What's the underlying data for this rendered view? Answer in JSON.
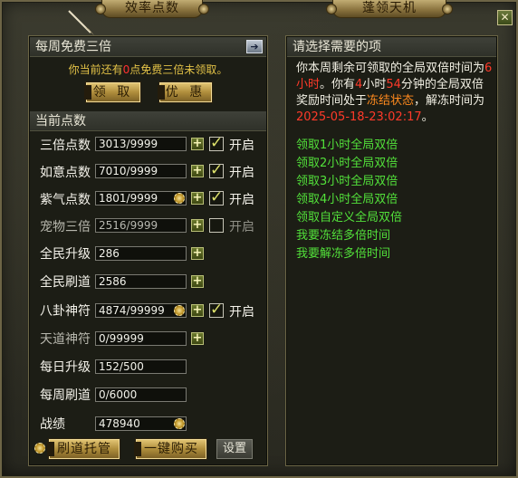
{
  "tabs": {
    "left": "效率点数",
    "right": "蓬领天机"
  },
  "left_panel": {
    "weekly_title": "每周免费三倍",
    "notice_pre": "你当前还有",
    "notice_num": "0",
    "notice_post": "点免费三倍未领取。",
    "claim_button": "领 取",
    "offer_button": "优 惠",
    "points_title": "当前点数",
    "rows": [
      {
        "label": "三倍点数",
        "value": "3013/9999",
        "toggle_label": "开启"
      },
      {
        "label": "如意点数",
        "value": "7010/9999",
        "toggle_label": "开启"
      },
      {
        "label": "紫气点数",
        "value": "1801/9999",
        "toggle_label": "开启"
      },
      {
        "label": "宠物三倍",
        "value": "2516/9999",
        "toggle_label": "开启"
      },
      {
        "label": "全民升级",
        "value": "286"
      },
      {
        "label": "全民刷道",
        "value": "2586"
      },
      {
        "label": "八卦神符",
        "value": "4874/99999",
        "toggle_label": "开启"
      },
      {
        "label": "天道神符",
        "value": "0/99999"
      },
      {
        "label": "每日升级",
        "value": "152/500"
      },
      {
        "label": "每周刷道",
        "value": "0/6000"
      },
      {
        "label": "战绩",
        "value": "478940"
      }
    ],
    "trustee_button": "刷道托管",
    "buy_button": "一键购买",
    "settings_button": "设置"
  },
  "right_panel": {
    "title": "请选择需要的项",
    "desc_1": "你本周剩余可领取的全局双倍时间为",
    "desc_hours1": "6",
    "desc_2": "小时",
    "desc_3": "。你有",
    "desc_hours2": "4",
    "desc_4": "小时",
    "desc_mins": "54",
    "desc_5": "分钟的全局双倍奖励时间处于",
    "desc_state": "冻结状态",
    "desc_6": "，解冻时间为",
    "desc_time": "2025-05-18-23:02:17",
    "desc_7": "。",
    "links": [
      "领取1小时全局双倍",
      "领取2小时全局双倍",
      "领取3小时全局双倍",
      "领取4小时全局双倍",
      "领取自定义全局双倍",
      "我要冻结多倍时间",
      "我要解冻多倍时间"
    ]
  },
  "colors": {
    "accent_gold": "#b08e3c",
    "link_green": "#52e03a",
    "warn_red": "#ff3a2a",
    "state_orange": "#ff8a1e"
  },
  "icons": {
    "close": "close-icon",
    "arrow": "arrow-right-icon",
    "gear": "gear-icon",
    "plus": "plus-icon",
    "brush": "brush-icon"
  }
}
